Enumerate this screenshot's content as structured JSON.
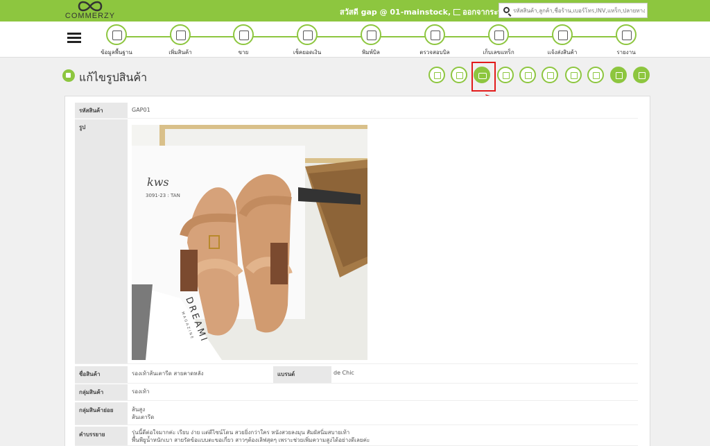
{
  "brand": {
    "logo_text": "COMMERZY"
  },
  "header": {
    "greeting": "สวัสดี gap @ 01-mainstock,",
    "logout": "ออกจากระบบ",
    "search_placeholder": "รหัสสินค้า,ลูกค้า,ชื่อร้าน,เบอร์โทร,INV,แทร็ก,ปลายทาง"
  },
  "nav": {
    "items": [
      {
        "label": "ข้อมูลพื้นฐาน",
        "icon": "database-icon"
      },
      {
        "label": "เพิ่มสินค้า",
        "icon": "box-icon"
      },
      {
        "label": "ขาย",
        "icon": "cash-register-icon"
      },
      {
        "label": "เช็คยอดเงิน",
        "icon": "money-check-icon"
      },
      {
        "label": "พิมพ์บิล",
        "icon": "printer-icon"
      },
      {
        "label": "ตรวจสอบบิล",
        "icon": "bill-check-icon"
      },
      {
        "label": "เก็บเลขแทร็ก",
        "icon": "tracking-icon"
      },
      {
        "label": "แจ้งส่งสินค้า",
        "icon": "truck-icon"
      },
      {
        "label": "รายงาน",
        "icon": "report-icon"
      }
    ]
  },
  "page": {
    "title": "แก้ไขรูปสินค้า"
  },
  "toolbar": [
    "document-icon",
    "pencil-icon",
    "camera-icon",
    "barcode-icon",
    "add-image-icon",
    "undo-icon",
    "copy-icon",
    "checklist-icon",
    "facebook-icon",
    "arrow-up-icon"
  ],
  "product": {
    "code_label": "รหัสสินค้า",
    "code": "GAP01",
    "image_label": "รูป",
    "name_label": "ชื่อสินค้า",
    "name": "รองเท้าส้นเตารีด สายคาดหลัง",
    "brand_label": "แบรนด์",
    "brand": "de Chic",
    "group_label": "กลุ่มสินค้า",
    "group": "รองเท้า",
    "subgroup_label": "กลุ่มสินค้าย่อย",
    "subgroup": "ส้นสูง\nส้นเตารีด",
    "desc_label": "คำบรรยาย",
    "desc": "รุ่นนี้ดีต่อใจมากค่ะ เรียบ ง่าย แต่ดีไซน์โดน สวยยิ่งกว่าใคร หนังสวยลงมุน สัมผัสนิ่มสบายเท้า\nพื้นพียูน้ำหนักเบา สายรัดข้อแบบตะขอเกี่ยว สาวๆต้องเลิฟสุดๆ เพราะช่วยเพิ่มความสูงได้อย่างดีเลยค่ะ"
  },
  "photo_text": {
    "brand_mark": "kws",
    "model": "3091-23 : TAN",
    "magazine": "DREAMI",
    "magazine_sub": "MAGAZINE"
  },
  "colors": {
    "accent": "#8dc63f",
    "highlight": "#e21b1b"
  }
}
